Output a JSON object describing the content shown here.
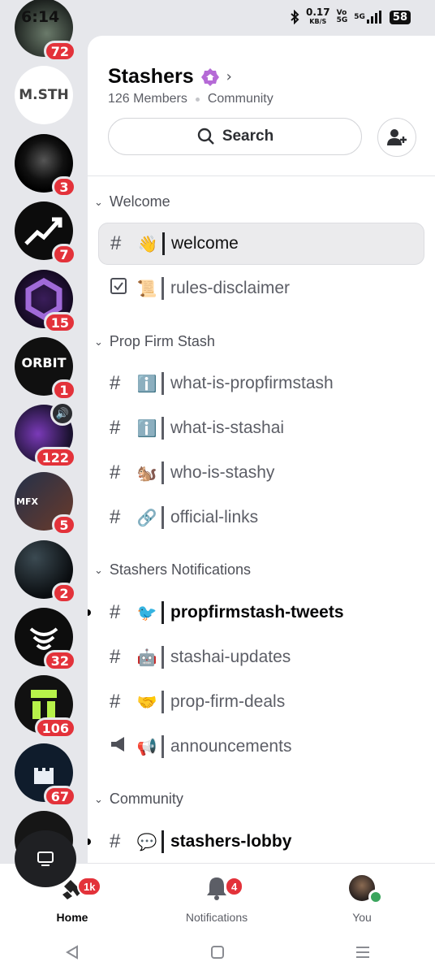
{
  "status_bar": {
    "time": "6:14",
    "speed": "0.17",
    "speed_unit": "KB/S",
    "net_top": "Vo",
    "net_bottom": "5G",
    "network": "5G",
    "battery": "58"
  },
  "servers": [
    {
      "badge": "72"
    },
    {
      "label": "M.STH"
    },
    {
      "badge": "3"
    },
    {
      "badge": "7"
    },
    {
      "badge": "15"
    },
    {
      "label": "ORBIT",
      "badge": "1"
    },
    {
      "badge": "122"
    },
    {
      "label": "MFX",
      "badge": "5"
    },
    {
      "badge": "2"
    },
    {
      "badge": "32"
    },
    {
      "badge": "106"
    },
    {
      "badge": "67"
    }
  ],
  "server": {
    "name": "Stashers",
    "members": "126 Members",
    "type": "Community"
  },
  "search": {
    "label": "Search"
  },
  "categories": [
    {
      "name": "Welcome",
      "channels": [
        {
          "emoji": "👋",
          "name": "welcome",
          "kind": "text"
        },
        {
          "emoji": "📜",
          "name": "rules-disclaimer",
          "kind": "rules"
        }
      ]
    },
    {
      "name": "Prop Firm Stash",
      "channels": [
        {
          "emoji": "ℹ️",
          "name": "what-is-propfirmstash",
          "kind": "text"
        },
        {
          "emoji": "ℹ️",
          "name": "what-is-stashai",
          "kind": "text"
        },
        {
          "emoji": "🐿️",
          "name": "who-is-stashy",
          "kind": "text"
        },
        {
          "emoji": "🔗",
          "name": "official-links",
          "kind": "text"
        }
      ]
    },
    {
      "name": "Stashers Notifications",
      "channels": [
        {
          "emoji": "🐦",
          "name": "propfirmstash-tweets",
          "kind": "text"
        },
        {
          "emoji": "🤖",
          "name": "stashai-updates",
          "kind": "text"
        },
        {
          "emoji": "🤝",
          "name": "prop-firm-deals",
          "kind": "text"
        },
        {
          "emoji": "📢",
          "name": "announcements",
          "kind": "announcement"
        }
      ]
    },
    {
      "name": "Community",
      "channels": [
        {
          "emoji": "💬",
          "name": "stashers-lobby",
          "kind": "text"
        }
      ]
    }
  ],
  "nav": {
    "home": {
      "label": "Home",
      "badge": "1k"
    },
    "notifications": {
      "label": "Notifications",
      "badge": "4"
    },
    "you": {
      "label": "You"
    }
  },
  "colors": {
    "badge": "#e3323a",
    "accent": "#b56ad6",
    "online": "#3ba55d"
  }
}
